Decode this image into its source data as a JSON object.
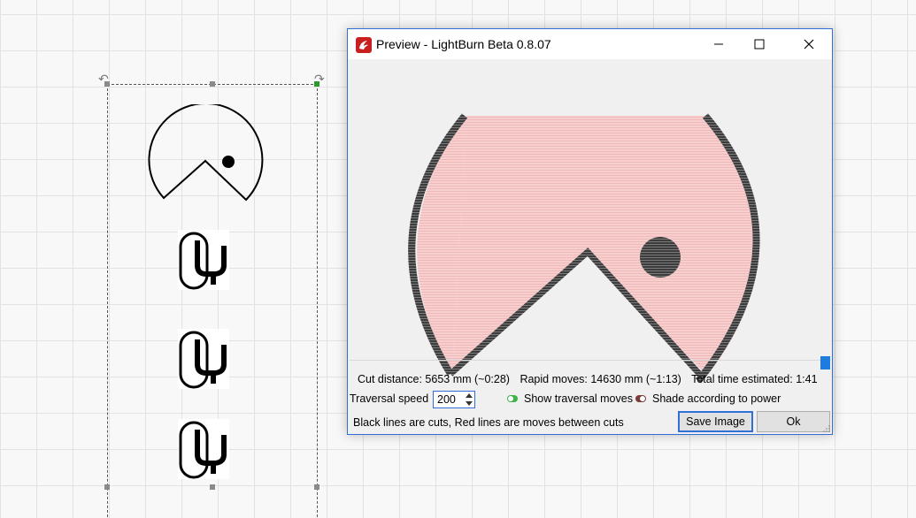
{
  "dialog": {
    "title": "Preview - LightBurn Beta 0.8.07",
    "stats": {
      "cut_distance": "Cut distance: 5653 mm (~0:28)",
      "rapid_moves": "Rapid moves: 14630 mm (~1:13)",
      "total_time": "Total time estimated: 1:41"
    },
    "progress": 1.0,
    "traversal_speed_label": "Traversal speed",
    "traversal_speed_value": "200",
    "show_traversal_label": "Show traversal moves",
    "show_traversal_on": true,
    "shade_power_label": "Shade according to power",
    "shade_power_on": false,
    "legend_text": "Black lines are cuts, Red lines are moves between cuts",
    "save_button": "Save Image",
    "ok_button": "Ok"
  },
  "icons": {
    "app": "lightburn-logo-icon",
    "minimize": "minimize-icon",
    "maximize": "maximize-icon",
    "close": "close-icon"
  },
  "colors": {
    "fill_pink": "#f5c9c9",
    "cut_dark": "#4a4a4a",
    "toggle_on": "#3cb44a",
    "toggle_off": "#7a3b3b",
    "accent": "#2f6fd6"
  }
}
